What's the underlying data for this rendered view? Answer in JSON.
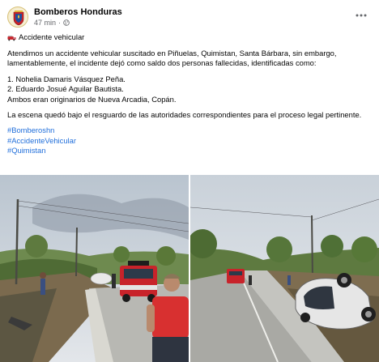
{
  "post": {
    "page_name": "Bomberos Honduras",
    "time": "47 min",
    "separator": "·",
    "privacy_icon": "globe-icon",
    "more_icon": "more-options-icon",
    "title_icon": "fire-truck-emoji",
    "title": "Accidente vehicular",
    "paragraph1": "Atendimos un accidente vehicular suscitado en Piñuelas, Quimistan, Santa Bárbara, sin embargo, lamentablemente, el incidente dejó como saldo dos personas fallecidas, identificadas como:",
    "victim1": "1. Nohelia Damaris Vásquez Peña.",
    "victim2": "2. Eduardo Josué Aguilar Bautista.",
    "origin": "Ambos eran originarios de Nueva Arcadia, Copán.",
    "paragraph2": "La escena quedó bajo el resguardo de las autoridades correspondientes para el proceso legal pertinente.",
    "hashtags": [
      "#Bomberoshn",
      "#AccidenteVehicular",
      "#Quimistan"
    ]
  },
  "colors": {
    "link": "#216fdb",
    "secondary_text": "#65676b",
    "fire_truck_red": "#c8232a",
    "shirt_red": "#d83030"
  },
  "photos": [
    {
      "name": "accident-scene-photo-1"
    },
    {
      "name": "accident-scene-photo-2"
    }
  ]
}
